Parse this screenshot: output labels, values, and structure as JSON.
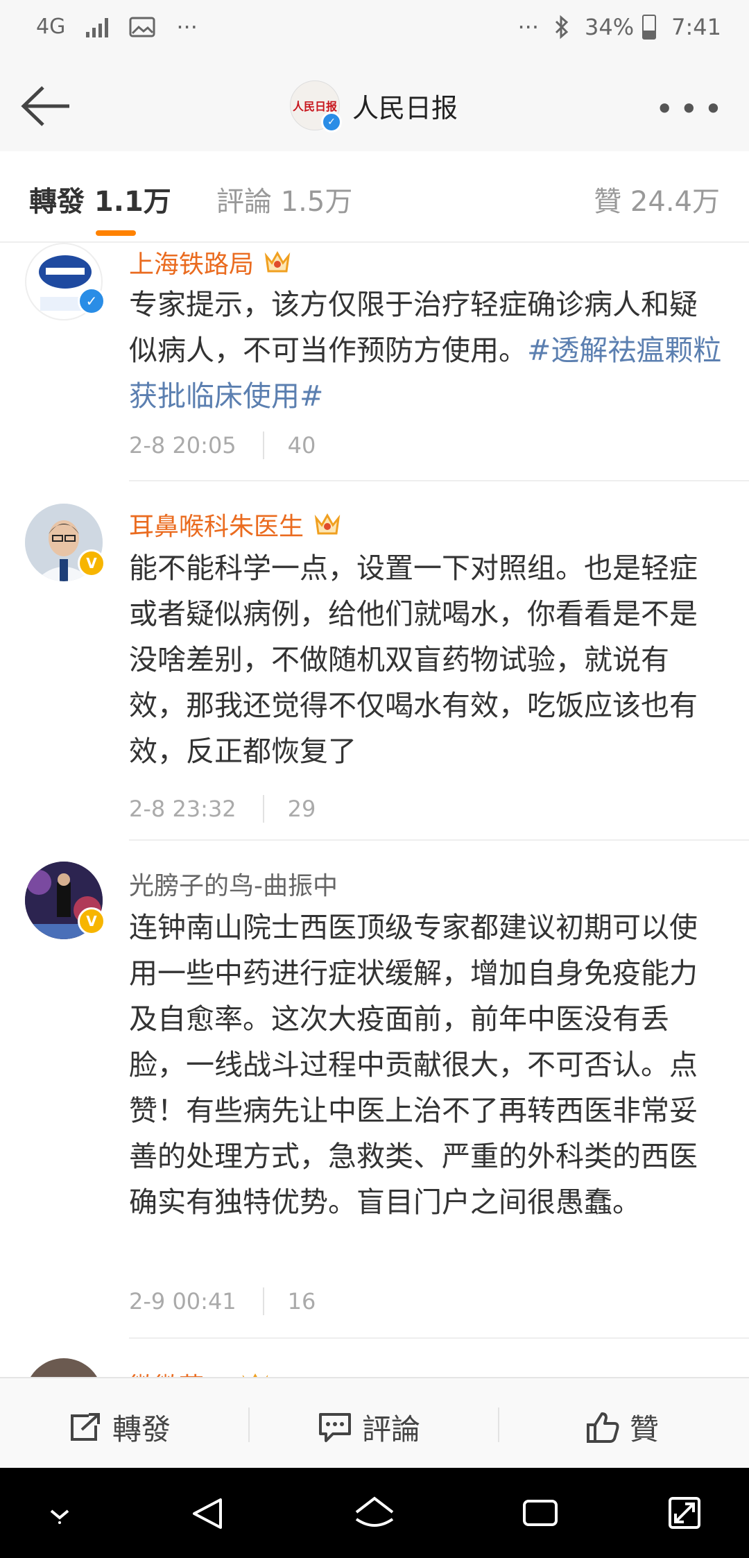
{
  "status_bar": {
    "network": "4G",
    "more_left": "···",
    "more_right": "···",
    "battery": "34%",
    "time": "7:41"
  },
  "nav": {
    "title": "人民日报",
    "logo_text": "人民日报"
  },
  "tabs": {
    "repost": "轉發 1.1万",
    "comment": "評論 1.5万",
    "like": "贊 24.4万"
  },
  "comments": [
    {
      "name": "上海铁路局",
      "text": "专家提示，该方仅限于治疗轻症确诊病人和疑似病人，不可当作预防方使用。",
      "topic": "#透解祛瘟颗粒获批临床使用#",
      "time": "2-8 20:05",
      "likes": "40"
    },
    {
      "name": "耳鼻喉科朱医生",
      "text": "能不能科学一点，设置一下对照组。也是轻症或者疑似病例，给他们就喝水，你看看是不是没啥差别，不做随机双盲药物试验，就说有效，那我还觉得不仅喝水有效，吃饭应该也有效，反正都恢复了",
      "time": "2-8 23:32",
      "likes": "29"
    },
    {
      "name": "光膀子的鸟-曲振中",
      "text": "连钟南山院士西医顶级专家都建议初期可以使用一些中药进行症状缓解，增加自身免疫能力及自愈率。这次大疫面前，前年中医没有丢脸，一线战斗过程中贡献很大，不可否认。点赞！有些病先让中医上治不了再转西医非常妥善的处理方式，急救类、严重的外科类的西医确实有独特优势。盲目门户之间很愚蠢。",
      "time": "2-9 00:41",
      "likes": "16"
    },
    {
      "name": "微微菇"
    }
  ],
  "actions": {
    "repost": "轉發",
    "comment": "評論",
    "like": "贊"
  },
  "colors": {
    "accent": "#ff8200",
    "vip_name": "#ea6b1f",
    "topic": "#5b7fb0"
  }
}
